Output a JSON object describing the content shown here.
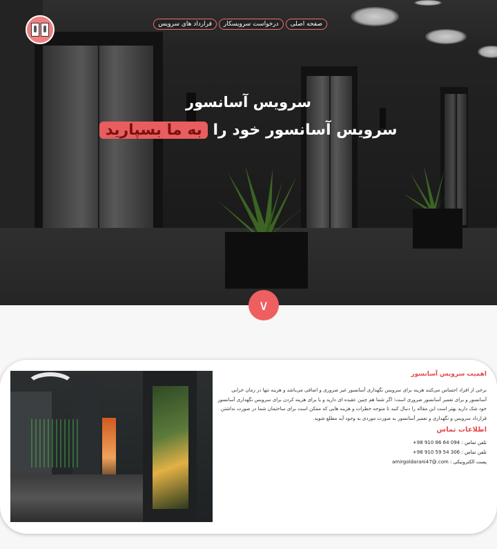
{
  "nav": {
    "items": [
      "قرارداد های سرویس",
      "درخواست سرویسکار",
      "صفحه اصلی"
    ]
  },
  "hero": {
    "title": "سرویس آسانسور",
    "subtitle_prefix": "سرویس آسانسور خود را",
    "subtitle_highlight": "به ما بسپارید",
    "scroll_button": "∨"
  },
  "card": {
    "heading": "اهمیت سرویس آسانسور",
    "paragraph": "برخی از افراد احساس می‌کنند هزینه برای سرویس نگهداری آسانسور غیر ضروری و اضافی می‌باشد و هزینه تنها در زمان خرابی آسانسور و برای تعمیر آسانسور ضروری است؛ اگر شما هم چنین عقیده ای دارید و یا برای هزینه کردن برای سرویس نگهداری آسانسور خود شک دارید بهتر است این مقاله را دنبال کنید تا متوجه خطرات و هزینه هایی که ممکن است برای ساختمان شما در صورت نداشتن قرارداد سرویس و نگهداری و تعمیر آسانسور به صورت موردی به وجود آید مطلع شوید.",
    "contact_heading": "اطلاعات تماس",
    "phone1_label": "تلفن تماس :",
    "phone1_value": "+98 910 86 64 094",
    "phone2_label": "تلفن تماس :",
    "phone2_value": "+98 910 59 54 306",
    "email_label": "پست الکترونیکی :",
    "email_value": "amirgoldarani47@.com"
  },
  "colors": {
    "accent": "#ef5f5f",
    "heading_red": "#e5484d"
  }
}
